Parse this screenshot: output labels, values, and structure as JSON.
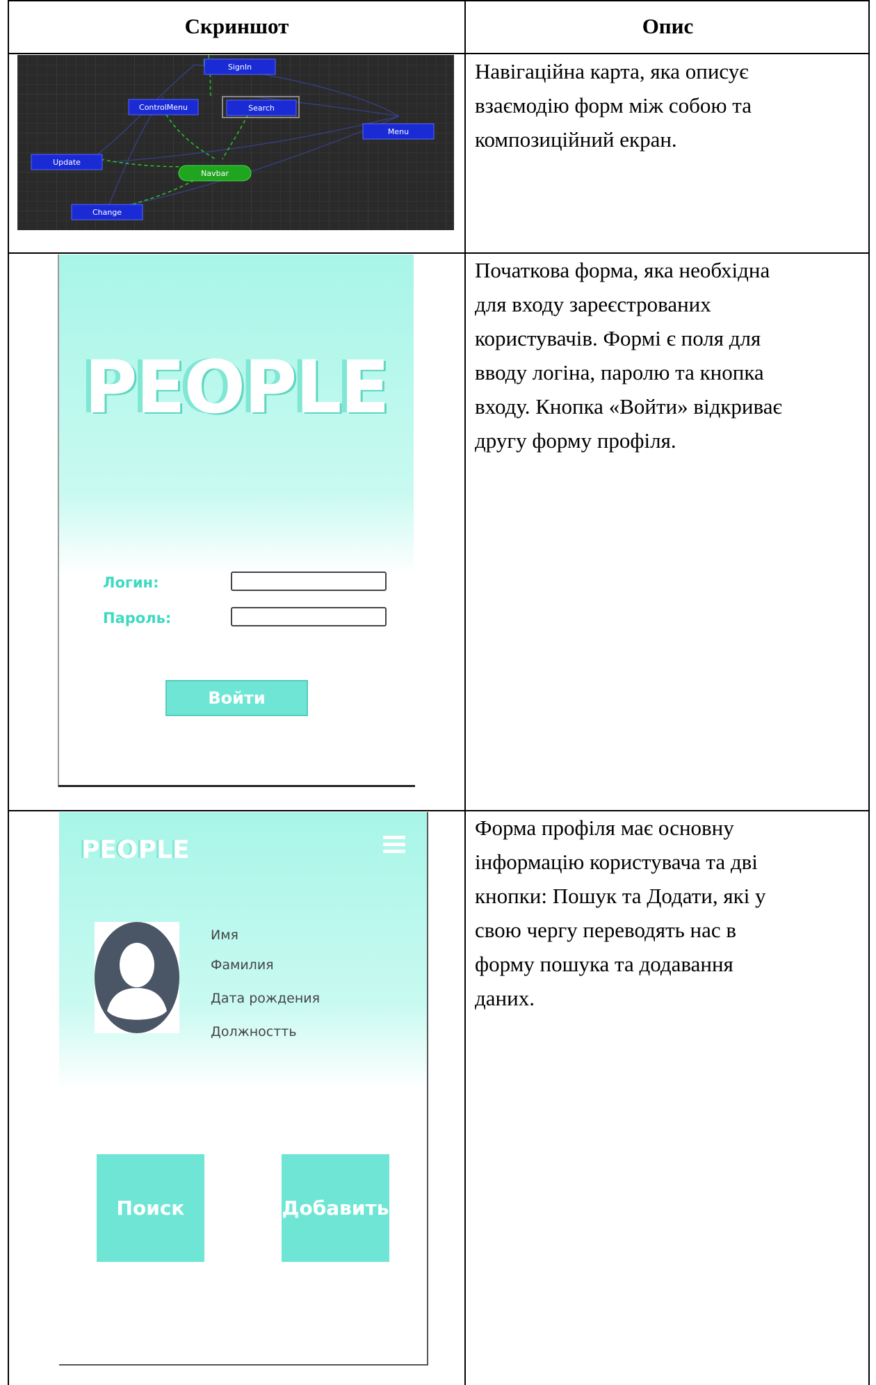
{
  "header": {
    "col1": "Скриншот",
    "col2": "Опис"
  },
  "rows": [
    {
      "description_lines": [
        "Навігаційна карта, яка описує",
        "взаємодію форм між собою та",
        "композиційний екран."
      ],
      "navmap": {
        "nodes": {
          "signin": "SignIn",
          "controlmenu": "ControlMenu",
          "search": "Search",
          "menu": "Menu",
          "update": "Update",
          "navbar": "Navbar",
          "change": "Change"
        }
      }
    },
    {
      "description_lines": [
        "Початкова форма, яка необхідна",
        "для входу зареєстрованих",
        "користувачів. Формі є поля для",
        "вводу логіна, паролю та кнопка",
        "входу. Кнопка «Войти» відкриває",
        "другу форму профіля."
      ],
      "login": {
        "logo": "PEOPLE",
        "login_label": "Логин:",
        "password_label": "Пароль:",
        "submit": "Войти"
      }
    },
    {
      "description_lines": [
        "Форма профіля має основну",
        "інформацію користувача та дві",
        "кнопки: Пошук та Додати, які у",
        "свою чергу переводять нас в",
        "форму пошука та додавання",
        "даних."
      ],
      "profile": {
        "logo": "PEOPLE",
        "fields": [
          "Имя",
          "Фамилия",
          "Дата рождения",
          "Должностть"
        ],
        "search_button": "Поиск",
        "add_button": "Добавить"
      }
    }
  ],
  "colors": {
    "mint": "#6fe6d5",
    "mint_light": "#a8f5e8",
    "node_blue": "#1a2bd6",
    "node_green": "#1fa51f",
    "avatar_dark": "#4a5566"
  }
}
